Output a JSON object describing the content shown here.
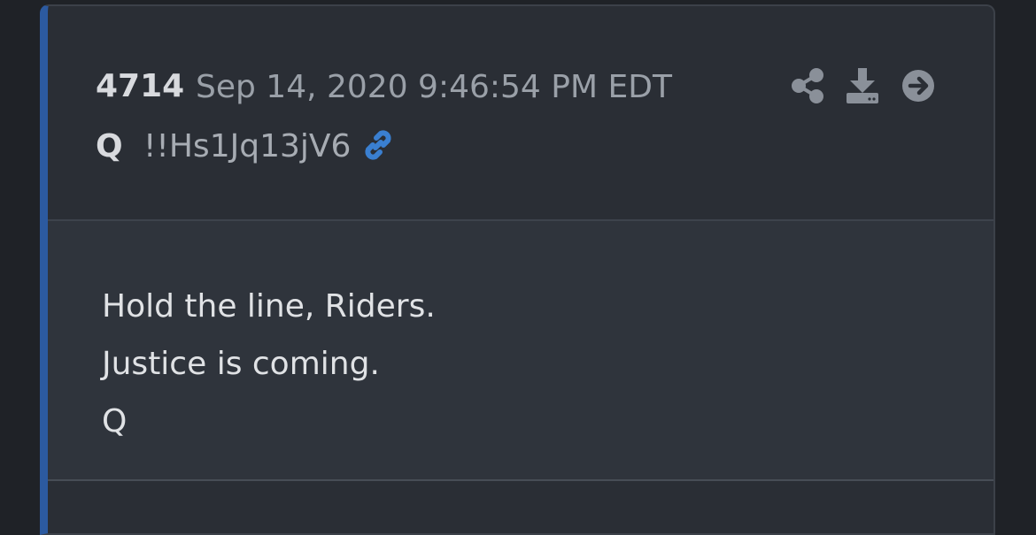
{
  "post": {
    "number": "4714",
    "date": "Sep 14, 2020 9:46:54 PM EDT",
    "author": "Q",
    "tripcode": "!!Hs1Jq13jV6",
    "body_lines": [
      "Hold the line, Riders.",
      "Justice is coming.",
      "Q"
    ]
  },
  "icons": {
    "link": "link-icon",
    "share": "share-icon",
    "download": "download-icon",
    "go": "arrow-right-circle-icon"
  },
  "colors": {
    "accent": "#2c5aa0",
    "link": "#3a7fd0",
    "icon_gray": "#8a9099"
  }
}
